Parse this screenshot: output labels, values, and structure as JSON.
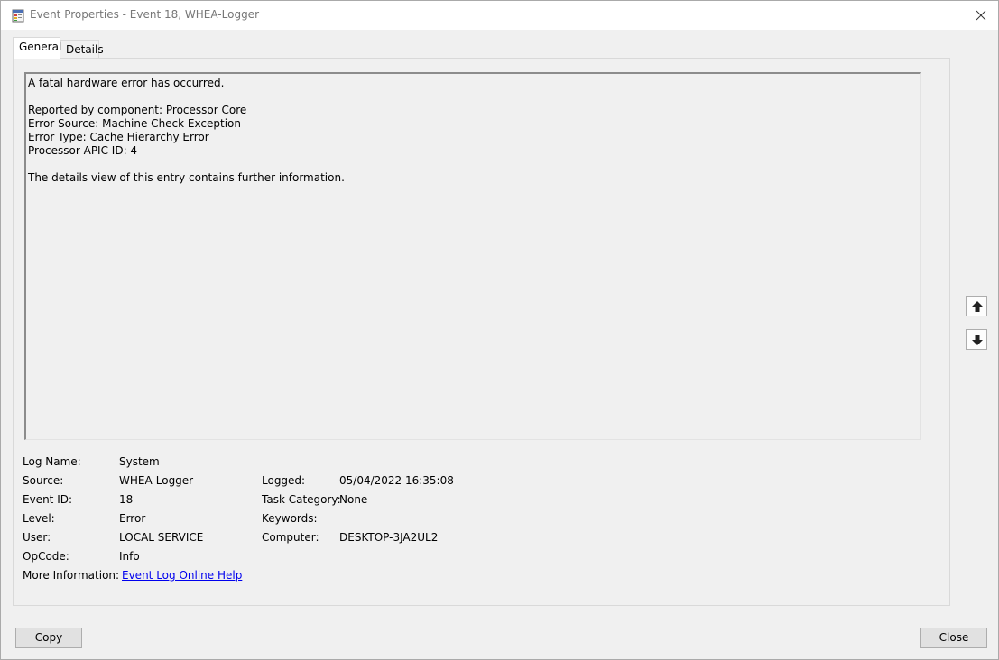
{
  "window": {
    "title": "Event Properties - Event 18, WHEA-Logger"
  },
  "tabs": {
    "general": "General",
    "details": "Details"
  },
  "description": {
    "lines": [
      "A fatal hardware error has occurred.",
      "",
      "Reported by component: Processor Core",
      "Error Source: Machine Check Exception",
      "Error Type: Cache Hierarchy Error",
      "Processor APIC ID: 4",
      "",
      "The details view of this entry contains further information."
    ]
  },
  "fields": {
    "log_name_label": "Log Name:",
    "log_name": "System",
    "source_label": "Source:",
    "source": "WHEA-Logger",
    "logged_label": "Logged:",
    "logged": "05/04/2022 16:35:08",
    "event_id_label": "Event ID:",
    "event_id": "18",
    "task_category_label": "Task Category:",
    "task_category": "None",
    "level_label": "Level:",
    "level": "Error",
    "keywords_label": "Keywords:",
    "keywords": "",
    "user_label": "User:",
    "user": "LOCAL SERVICE",
    "computer_label": "Computer:",
    "computer": "DESKTOP-3JA2UL2",
    "opcode_label": "OpCode:",
    "opcode": "Info",
    "more_info_label": "More Information:",
    "more_info_link": "Event Log Online Help"
  },
  "buttons": {
    "copy": "Copy",
    "close": "Close"
  },
  "icons": {
    "app": "event-viewer-icon",
    "close": "close-icon",
    "up": "arrow-up-icon",
    "down": "arrow-down-icon"
  }
}
